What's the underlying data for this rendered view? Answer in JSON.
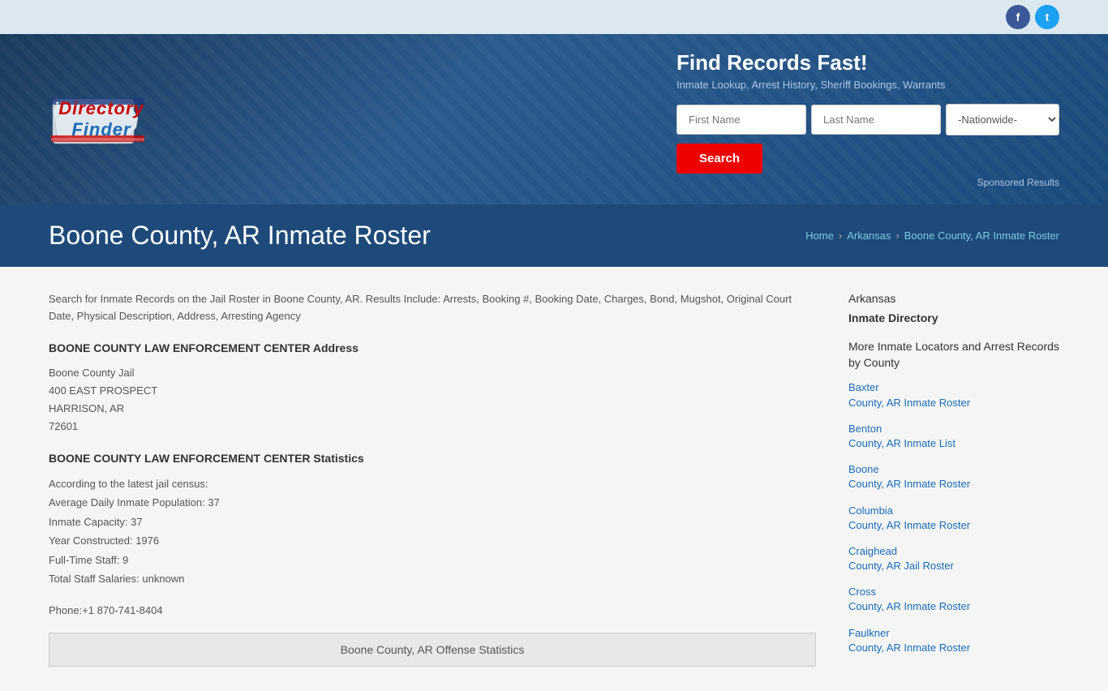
{
  "social": {
    "facebook_label": "f",
    "twitter_label": "t"
  },
  "header": {
    "logo_text_directory": "Directory",
    "logo_text_finder": "Finder",
    "tagline": "Find Records Fast!",
    "subtitle": "Inmate Lookup, Arrest History, Sheriff Bookings, Warrants",
    "first_name_placeholder": "First Name",
    "last_name_placeholder": "Last Name",
    "search_button": "Search",
    "dropdown_default": "-Nationwide-",
    "sponsored": "Sponsored Results"
  },
  "page_title": {
    "title": "Boone County, AR Inmate Roster",
    "breadcrumb_home": "Home",
    "breadcrumb_state": "Arkansas",
    "breadcrumb_current": "Boone County, AR Inmate Roster"
  },
  "main": {
    "intro": "Search for Inmate Records on the Jail Roster in Boone County, AR. Results Include: Arrests, Booking #, Booking Date, Charges, Bond, Mugshot, Original Court Date, Physical Description, Address, Arresting Agency",
    "address_section_title": "BOONE COUNTY LAW ENFORCEMENT CENTER Address",
    "address_lines": [
      "Boone County Jail",
      "400 EAST PROSPECT",
      "HARRISON, AR",
      "72601"
    ],
    "stats_section_title": "BOONE COUNTY LAW ENFORCEMENT CENTER Statistics",
    "stats_lines": [
      "According to the latest jail census:",
      "Average Daily Inmate Population: 37",
      "Inmate Capacity: 37",
      "Year Constructed: 1976",
      "Full-Time Staff: 9",
      "Total Staff Salaries: unknown"
    ],
    "phone": "Phone:+1 870-741-8404",
    "offense_table_header": "Boone County, AR Offense Statistics"
  },
  "sidebar": {
    "state_label": "Arkansas",
    "directory_label": "Inmate Directory",
    "more_label": "More Inmate Locators and Arrest Records by County",
    "links": [
      {
        "label": "Baxter County, AR Inmate Roster",
        "line1": "Baxter",
        "line2": "County, AR Inmate Roster"
      },
      {
        "label": "Benton County, AR Inmate List",
        "line1": "Benton",
        "line2": "County, AR Inmate List"
      },
      {
        "label": "Boone County, AR Inmate Roster",
        "line1": "Boone",
        "line2": "County, AR Inmate Roster"
      },
      {
        "label": "Columbia County, AR Inmate Roster",
        "line1": "Columbia",
        "line2": "County, AR Inmate Roster"
      },
      {
        "label": "Craighead County, AR Jail Roster",
        "line1": "Craighead",
        "line2": "County, AR Jail Roster"
      },
      {
        "label": "Cross County, AR Inmate Roster",
        "line1": "Cross",
        "line2": "County, AR Inmate Roster"
      },
      {
        "label": "Faulkner County, AR Inmate Roster",
        "line1": "Faulkner",
        "line2": "County, AR Inmate Roster"
      }
    ]
  }
}
